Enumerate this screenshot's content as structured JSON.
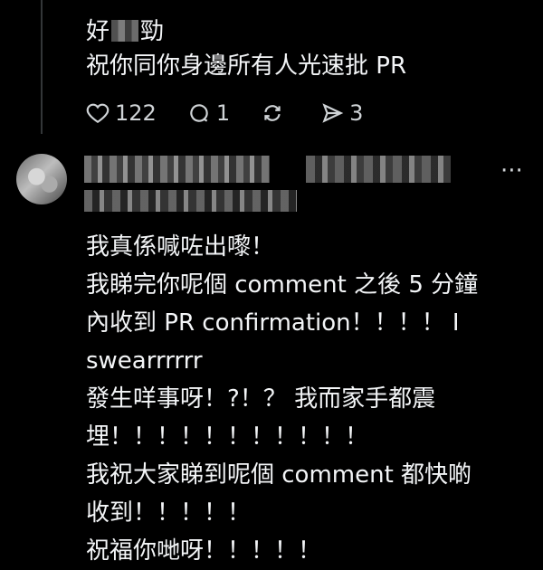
{
  "reply": {
    "line1_prefix": "好",
    "line1_suffix": "勁",
    "line2": "祝你同你身邊所有人光速批 PR",
    "likes": "122",
    "replies": "1",
    "shares": "3"
  },
  "comment": {
    "more_icon": "···",
    "lines": [
      "我真係喊咗出嚟！",
      "我睇完你呢個 comment 之後  5 分鐘",
      "內收到 PR confirmation！！！！ I",
      "swearrrrrr",
      "發生咩事呀！?！？  我而家手都震",
      "埋！！！！！！！！！！！",
      "我祝大家睇到呢個 comment 都快啲",
      "收到！！！！！",
      "祝福你哋呀！！！！！"
    ]
  }
}
